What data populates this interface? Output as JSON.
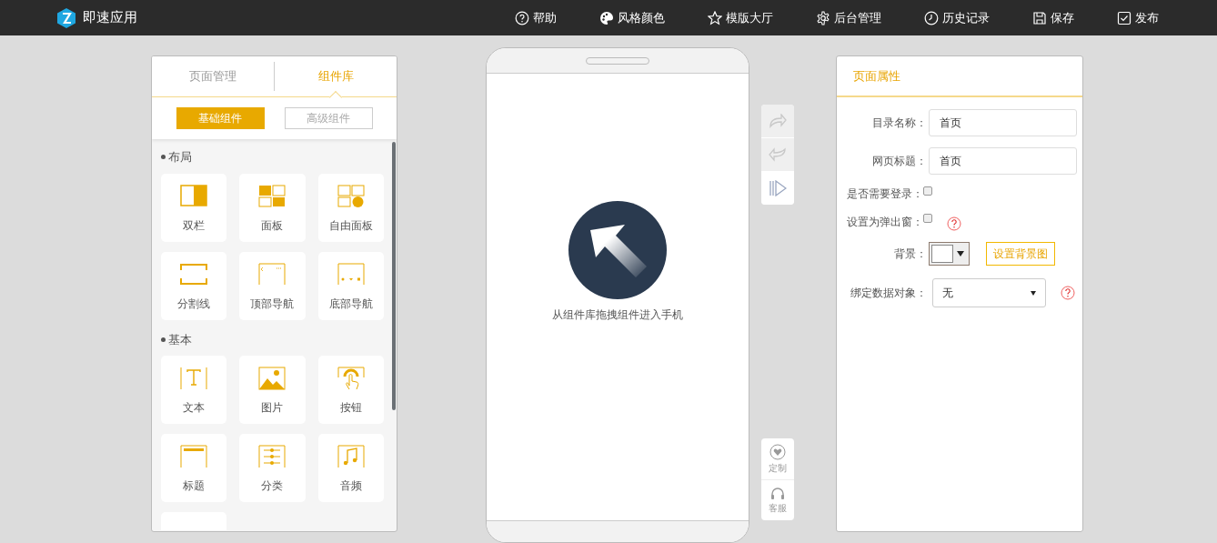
{
  "app": {
    "title": "即速应用"
  },
  "nav_items": [
    {
      "label": "帮助"
    },
    {
      "label": "风格颜色"
    },
    {
      "label": "模版大厅"
    },
    {
      "label": "后台管理"
    },
    {
      "label": "历史记录"
    },
    {
      "label": "保存"
    },
    {
      "label": "发布"
    }
  ],
  "left_panel": {
    "tabs": [
      {
        "label": "页面管理",
        "selected": false
      },
      {
        "label": "组件库",
        "selected": true
      }
    ],
    "sub_tabs": [
      {
        "label": "基础组件",
        "selected": true
      },
      {
        "label": "高级组件",
        "selected": false
      }
    ],
    "sections": [
      {
        "title": "布局",
        "items": [
          {
            "label": "双栏"
          },
          {
            "label": "面板"
          },
          {
            "label": "自由面板"
          },
          {
            "label": "分割线"
          },
          {
            "label": "顶部导航"
          },
          {
            "label": "底部导航"
          }
        ]
      },
      {
        "title": "基本",
        "items": [
          {
            "label": "文本"
          },
          {
            "label": "图片"
          },
          {
            "label": "按钮"
          },
          {
            "label": "标题"
          },
          {
            "label": "分类"
          },
          {
            "label": "音频"
          }
        ]
      }
    ]
  },
  "phone": {
    "hint": "从组件库拖拽组件进入手机"
  },
  "side_tools": [
    {
      "label": "定制"
    },
    {
      "label": "客服"
    }
  ],
  "right_panel": {
    "title": "页面属性",
    "fields": [
      {
        "kind": "text",
        "label": "目录名称：",
        "value": "首页"
      },
      {
        "kind": "text",
        "label": "网页标题：",
        "value": "首页"
      },
      {
        "kind": "checkbox",
        "label": "是否需要登录：",
        "checked": false
      },
      {
        "kind": "checkbox",
        "label": "设置为弹出窗：",
        "checked": false,
        "help": true
      },
      {
        "kind": "color",
        "label": "背景：",
        "button": "设置背景图"
      },
      {
        "kind": "select",
        "label": "绑定数据对象：",
        "value": "无",
        "help": true
      }
    ]
  }
}
